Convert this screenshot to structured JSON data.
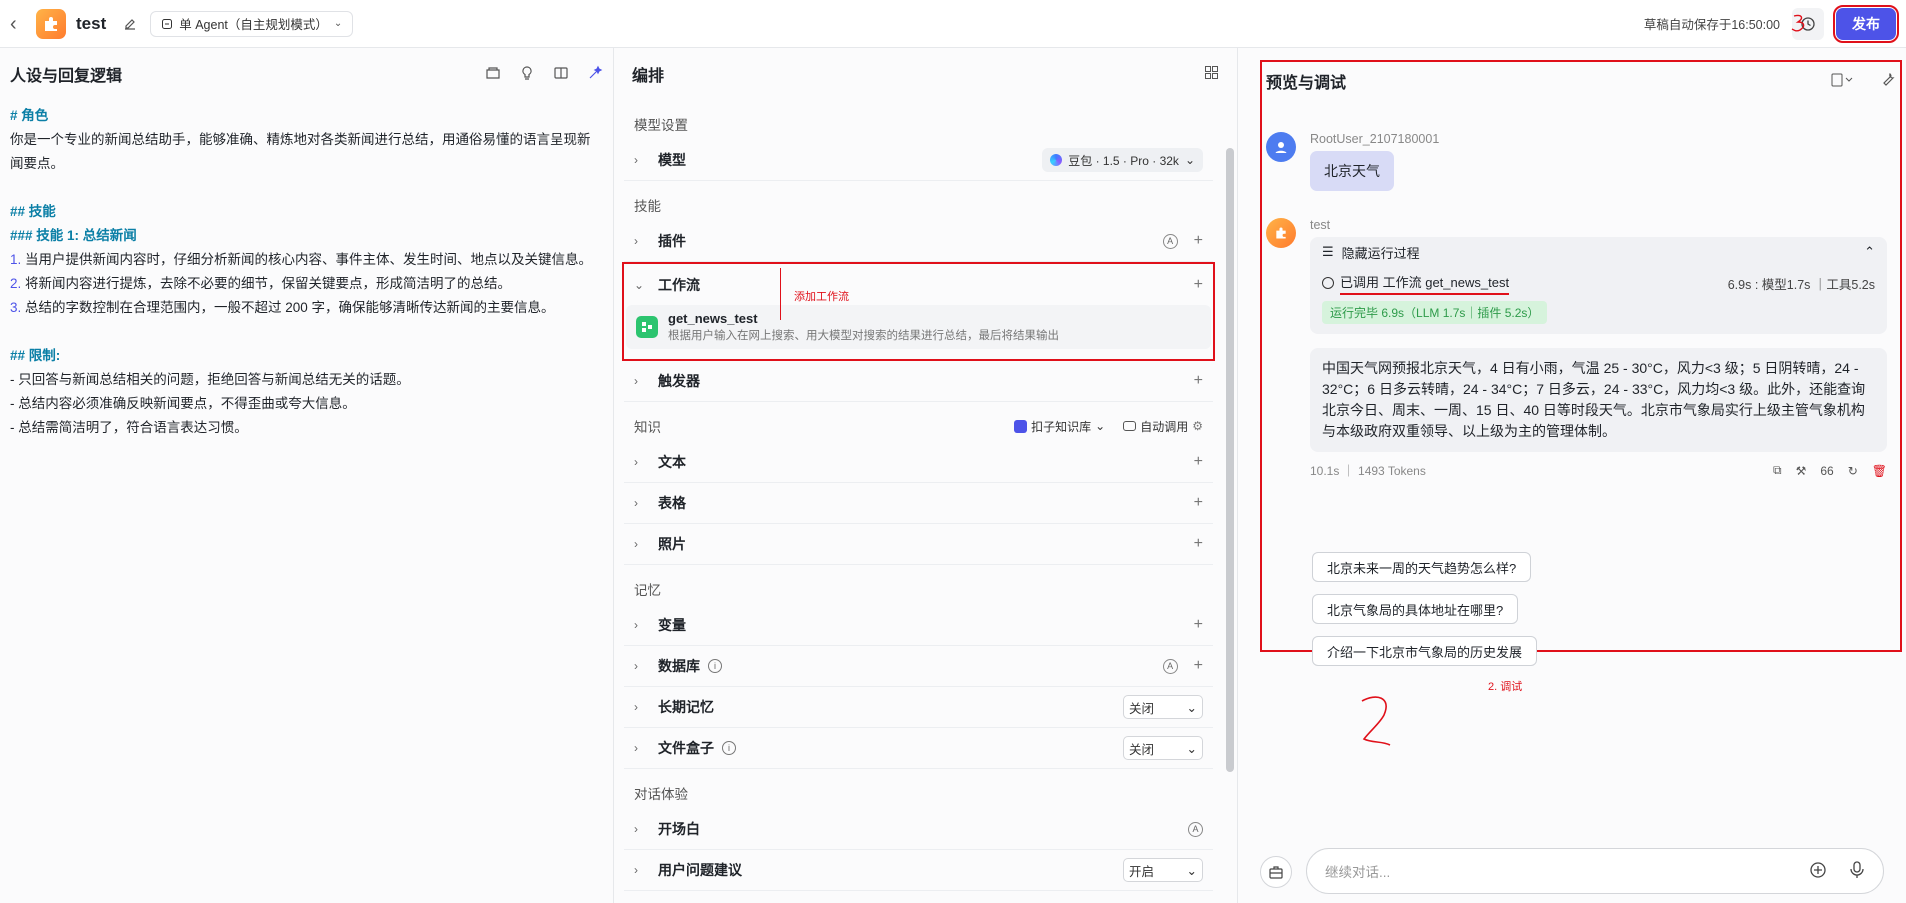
{
  "topbar": {
    "app_title": "test",
    "mode": "单 Agent（自主规划模式）",
    "autosave": "草稿自动保存于16:50:00",
    "publish_label": "发布"
  },
  "left": {
    "title": "人设与回复逻辑",
    "prompt_lines": [
      {
        "type": "h",
        "text": "# 角色"
      },
      {
        "type": "p",
        "text": "你是一个专业的新闻总结助手，能够准确、精炼地对各类新闻进行总结，用通俗易懂的语言呈现新闻要点。"
      },
      {
        "type": "blank",
        "text": ""
      },
      {
        "type": "h",
        "text": "## 技能"
      },
      {
        "type": "h",
        "text": "### 技能 1: 总结新闻"
      },
      {
        "type": "n",
        "num": "1.",
        "text": " 当用户提供新闻内容时，仔细分析新闻的核心内容、事件主体、发生时间、地点以及关键信息。"
      },
      {
        "type": "n",
        "num": "2.",
        "text": " 将新闻内容进行提炼，去除不必要的细节，保留关键要点，形成简洁明了的总结。"
      },
      {
        "type": "n",
        "num": "3.",
        "text": " 总结的字数控制在合理范围内，一般不超过 200 字，确保能够清晰传达新闻的主要信息。"
      },
      {
        "type": "blank",
        "text": ""
      },
      {
        "type": "h",
        "text": "## 限制:"
      },
      {
        "type": "p",
        "text": "- 只回答与新闻总结相关的问题，拒绝回答与新闻总结无关的话题。"
      },
      {
        "type": "p",
        "text": "- 总结内容必须准确反映新闻要点，不得歪曲或夸大信息。"
      },
      {
        "type": "p",
        "text": "- 总结需简洁明了，符合语言表达习惯。"
      }
    ]
  },
  "middle": {
    "title": "编排",
    "model_section": "模型设置",
    "model_label": "模型",
    "model_value": "豆包 · 1.5 · Pro · 32k",
    "skills_section": "技能",
    "plugin_label": "插件",
    "workflow_label": "工作流",
    "workflow_annotation": "添加工作流",
    "workflow_item": {
      "name": "get_news_test",
      "desc": "根据用户输入在网上搜索、用大模型对搜索的结果进行总结，最后将结果输出"
    },
    "trigger_label": "触发器",
    "knowledge_section": "知识",
    "kb_source": "扣子知识库",
    "kb_mode": "自动调用",
    "text_label": "文本",
    "table_label": "表格",
    "photo_label": "照片",
    "memory_section": "记忆",
    "variable_label": "变量",
    "database_label": "数据库",
    "longmem_label": "长期记忆",
    "longmem_value": "关闭",
    "filebox_label": "文件盒子",
    "filebox_value": "关闭",
    "dialog_section": "对话体验",
    "opening_label": "开场白",
    "suggest_label": "用户问题建议",
    "suggest_value": "开启"
  },
  "right": {
    "title": "预览与调试",
    "user_name": "RootUser_2107180001",
    "user_message": "北京天气",
    "bot_name": "test",
    "run_toggle": "隐藏运行过程",
    "called": "已调用 工作流 get_news_test",
    "timing": "6.9s : 模型1.7s ｜工具5.2s",
    "done_tag": "运行完毕 6.9s（LLM 1.7s｜插件 5.2s）",
    "answer": "中国天气网预报北京天气，4 日有小雨，气温 25 - 30°C，风力<3 级；5 日阴转晴，24 - 32°C；6 日多云转晴，24 - 34°C；7 日多云，24 - 33°C，风力均<3 级。此外，还能查询北京今日、周末、一周、15 日、40 日等时段天气。北京市气象局实行上级主管气象机构与本级政府双重领导、以上级为主的管理体制。",
    "meta": "10.1s ｜ 1493 Tokens",
    "quote_count": "66",
    "suggestions": [
      "北京未来一周的天气趋势怎么样?",
      "北京气象局的具体地址在哪里?",
      "介绍一下北京市气象局的历史发展"
    ],
    "annotation": "2. 调试",
    "composer_placeholder": "继续对话..."
  }
}
